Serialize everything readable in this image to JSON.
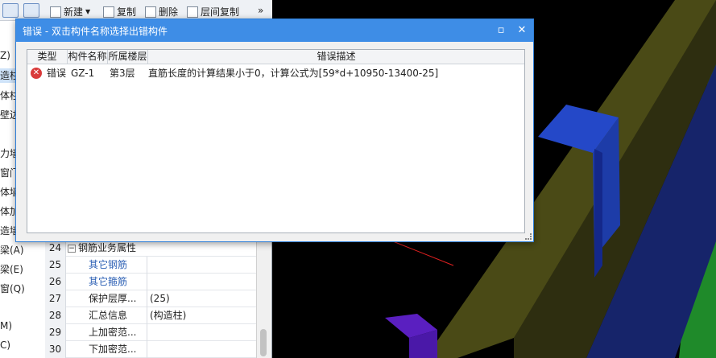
{
  "toolbar": {
    "new_label": "新建",
    "copy_label": "复制",
    "delete_label": "删除",
    "floor_copy_label": "层间复制",
    "more_label": "»"
  },
  "tree_items": [
    "Z)",
    "造柱(",
    "体柱(",
    "壁边缘",
    "力墙(",
    "窗门框",
    "体墙(",
    "体加筋",
    "造墙(",
    "梁(A)",
    "梁(E)",
    "窗(Q)",
    "M)",
    "C)"
  ],
  "properties": [
    {
      "num": "24",
      "name": "钢筋业务属性",
      "value": "",
      "group": true
    },
    {
      "num": "25",
      "name": "其它钢筋",
      "value": "",
      "link": true
    },
    {
      "num": "26",
      "name": "其它箍筋",
      "value": "",
      "link": true
    },
    {
      "num": "27",
      "name": "保护层厚...",
      "value": "(25)"
    },
    {
      "num": "28",
      "name": "汇总信息",
      "value": "(构造柱)"
    },
    {
      "num": "29",
      "name": "上加密范...",
      "value": ""
    },
    {
      "num": "30",
      "name": "下加密范...",
      "value": ""
    }
  ],
  "dialog": {
    "title": "错误 - 双击构件名称选择出错构件",
    "columns": [
      "类型",
      "构件名称",
      "所属楼层",
      "错误描述"
    ],
    "rows": [
      {
        "type": "错误",
        "name": "GZ-1",
        "floor": "第3层",
        "desc": "直筋长度的计算结果小于0，计算公式为[59*d+10950-13400-25]"
      }
    ]
  },
  "colors": {
    "title_bar": "#3e8de6",
    "error_red": "#d93a3a",
    "viewport_bg": "#000000",
    "beam_olive": "#4a4a16",
    "column_blue": "#1d3ca8",
    "slab_green": "#1f8a2a",
    "navy": "#16246a",
    "purple": "#5a1fc0"
  }
}
